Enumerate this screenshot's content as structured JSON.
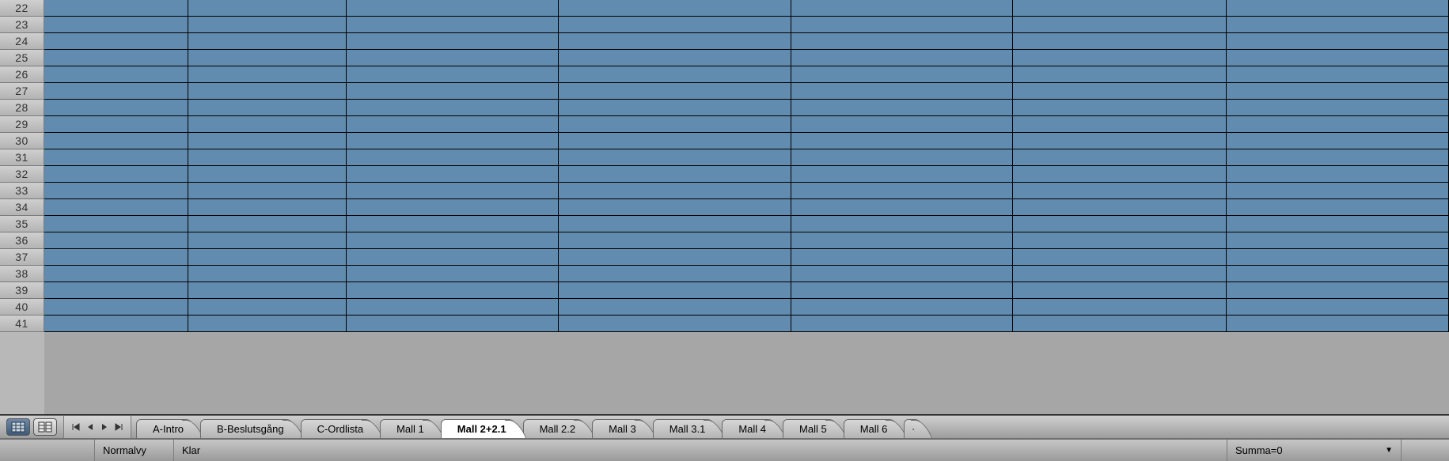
{
  "grid": {
    "first_row": 22,
    "last_row": 41,
    "column_count": 7
  },
  "tabs": [
    {
      "label": "A-Intro",
      "active": false
    },
    {
      "label": "B-Beslutsgång",
      "active": false
    },
    {
      "label": "C-Ordlista",
      "active": false
    },
    {
      "label": "Mall 1",
      "active": false
    },
    {
      "label": "Mall 2+2.1",
      "active": true
    },
    {
      "label": "Mall 2.2",
      "active": false
    },
    {
      "label": "Mall 3",
      "active": false
    },
    {
      "label": "Mall 3.1",
      "active": false
    },
    {
      "label": "Mall 4",
      "active": false
    },
    {
      "label": "Mall 5",
      "active": false
    },
    {
      "label": "Mall 6",
      "active": false
    }
  ],
  "add_tab_label": "+",
  "status": {
    "view_mode": "Normalvy",
    "message": "Klar",
    "sum": "Summa=0"
  }
}
